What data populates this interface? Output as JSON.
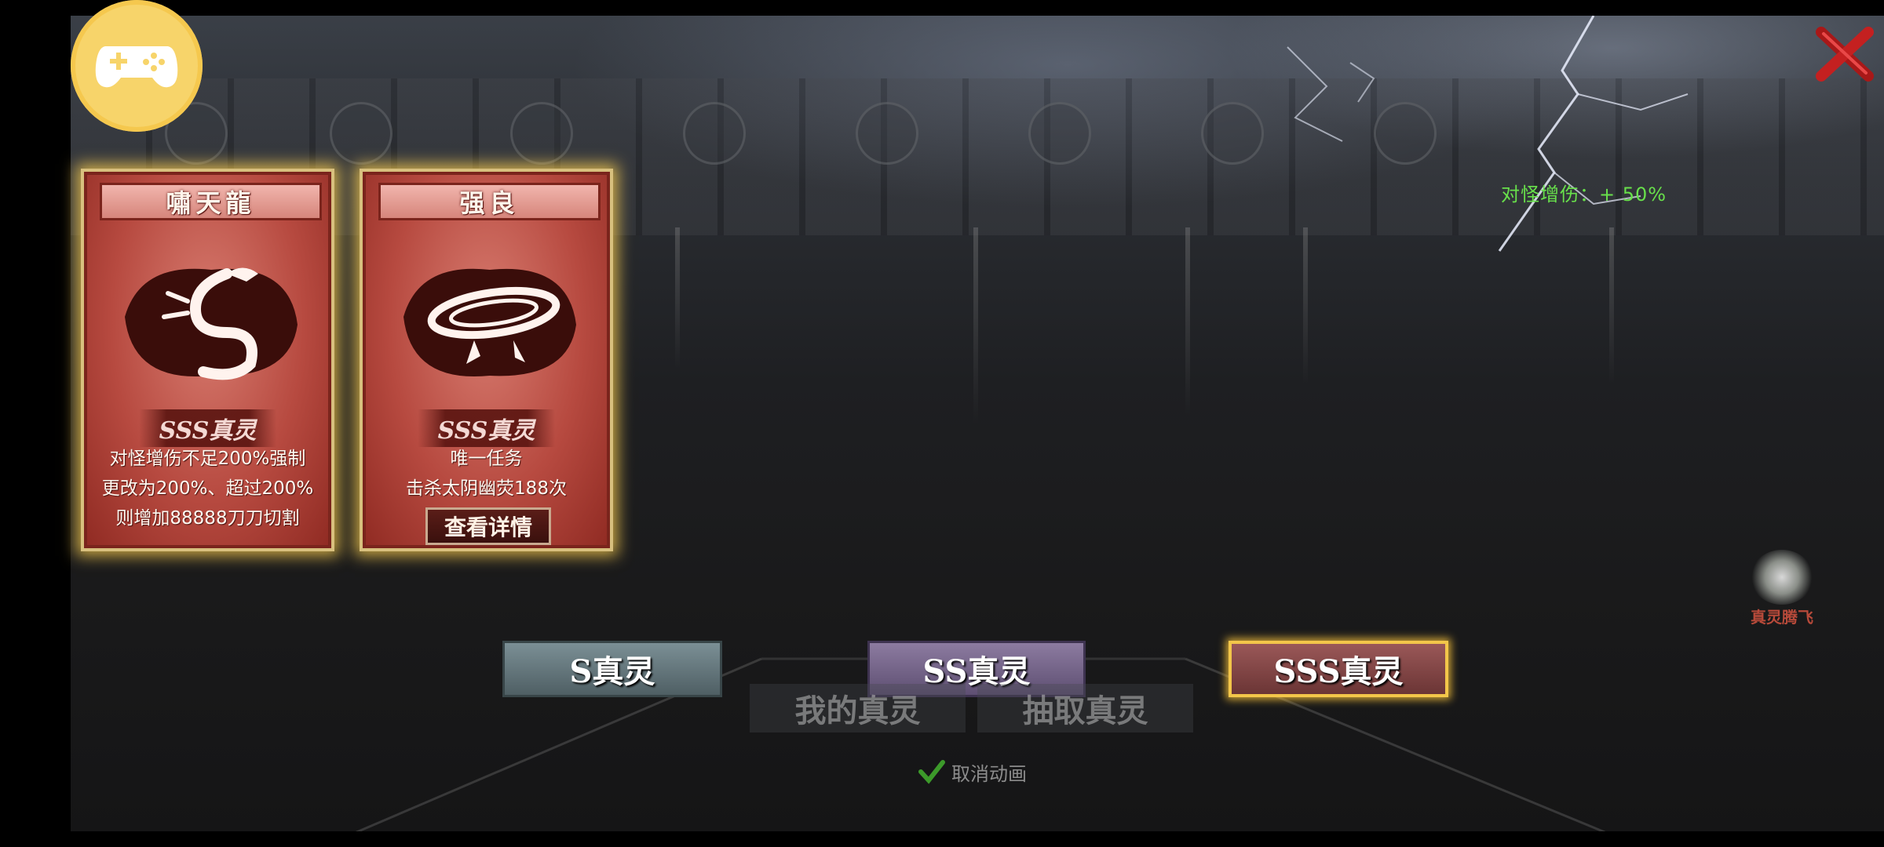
{
  "top_bar": {
    "app_icon": "gamepad-icon",
    "close_icon": "close-x-icon"
  },
  "buff": {
    "text": "对怪增伤：+ 50%"
  },
  "cards": [
    {
      "title": "嘯天龍",
      "emblem_icon": "dragon-icon",
      "rank": "SSS真灵",
      "description_lines": [
        "对怪增伤不足200%强制",
        "更改为200%、超过200%",
        "则增加88888刀刀切割"
      ]
    },
    {
      "title": "强良",
      "emblem_icon": "whirlwind-icon",
      "rank": "SSS真灵",
      "description_lines": [
        "唯一任务",
        "击杀太阴幽荧188次"
      ],
      "detail_button": "查看详情"
    }
  ],
  "grade_tabs": [
    {
      "label": "S真灵",
      "selected": false
    },
    {
      "label": "SS真灵",
      "selected": false
    },
    {
      "label": "SSS真灵",
      "selected": true
    }
  ],
  "sub_tabs": [
    {
      "label": "我的真灵"
    },
    {
      "label": "抽取真灵"
    }
  ],
  "skip_animation": {
    "label": "取消动画",
    "checked": true
  },
  "side_entry": {
    "label": "真灵腾飞",
    "icon": "lotus-icon"
  },
  "colors": {
    "buff_green": "#68e04b",
    "card_red": "#b74a40",
    "selected_gold": "#f3c64a"
  }
}
